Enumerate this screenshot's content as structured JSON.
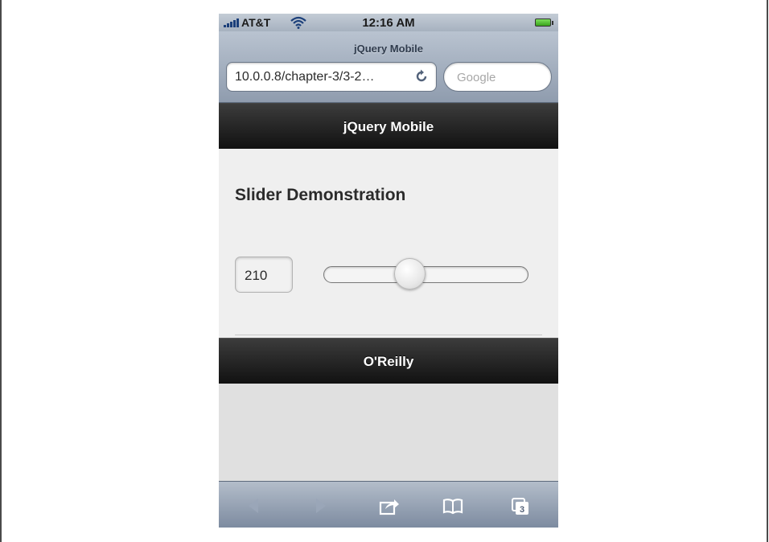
{
  "status_bar": {
    "carrier": "AT&T",
    "time": "12:16 AM",
    "icons": [
      "signal-bars-icon",
      "wifi-icon",
      "battery-icon"
    ]
  },
  "browser": {
    "page_title": "jQuery Mobile",
    "url": "10.0.0.8/chapter-3/3-2…",
    "search_placeholder": "Google",
    "tabs_count": "3",
    "toolbar_icons": [
      "back-icon",
      "forward-icon",
      "share-icon",
      "bookmarks-icon",
      "tabs-icon"
    ]
  },
  "page": {
    "header_title": "jQuery Mobile",
    "heading": "Slider Demonstration",
    "slider": {
      "value": "210",
      "fraction": 0.42
    },
    "footer_title": "O'Reilly"
  },
  "colors": {
    "bar_dark": "#1e1e1e",
    "content_bg": "#efefef",
    "chrome_blue": "#8f9cae"
  }
}
